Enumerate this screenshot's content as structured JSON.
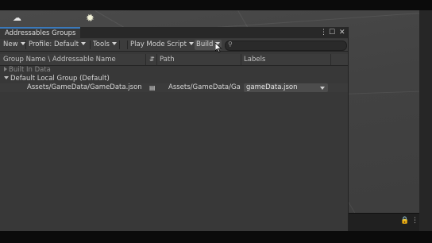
{
  "window": {
    "tab_title": "Addressables Groups",
    "controls": {
      "menu": "⋮",
      "maximize": "☐",
      "close": "✕"
    }
  },
  "toolbar": {
    "new_label": "New",
    "profile_label": "Profile: Default",
    "tools_label": "Tools",
    "play_mode_label": "Play Mode Script",
    "build_label": "Build",
    "search_placeholder": ""
  },
  "columns": {
    "group_name": "Group Name \\ Addressable Name",
    "path": "Path",
    "labels": "Labels"
  },
  "rows": {
    "built_in": "Built In Data",
    "default_group": "Default Local Group (Default)",
    "entry_name": "Assets/GameData/GameData.json",
    "entry_path": "Assets/GameData/Gan",
    "entry_label": "gameData.json"
  },
  "scene_panel": {
    "lock": "🔒",
    "menu": "⋮"
  },
  "colors": {
    "tab_accent": "#3a79bb",
    "panel_bg": "#383838"
  }
}
